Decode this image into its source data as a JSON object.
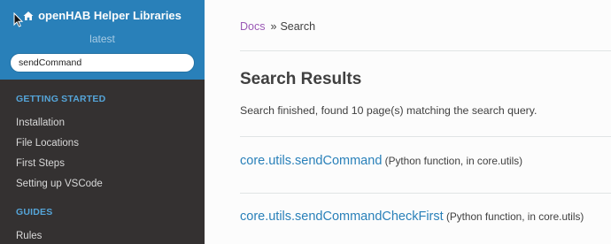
{
  "sidebar": {
    "brand": "openHAB Helper Libraries",
    "version": "latest",
    "search_value": "sendCommand",
    "sections": [
      {
        "caption": "GETTING STARTED",
        "items": [
          "Installation",
          "File Locations",
          "First Steps",
          "Setting up VSCode"
        ]
      },
      {
        "caption": "GUIDES",
        "items": [
          "Rules"
        ]
      }
    ]
  },
  "breadcrumb": {
    "home": "Docs",
    "separator": "»",
    "current": "Search"
  },
  "main": {
    "title": "Search Results",
    "summary": "Search finished, found 10 page(s) matching the search query.",
    "results": [
      {
        "link": "core.utils.sendCommand",
        "desc": "(Python function, in core.utils)"
      },
      {
        "link": "core.utils.sendCommandCheckFirst",
        "desc": "(Python function, in core.utils)"
      }
    ]
  },
  "colors": {
    "sidebar_top": "#2980b9",
    "sidebar_bg": "#343131",
    "caption": "#55a5d9",
    "link": "#2980b9",
    "breadcrumb_link": "#9b59b6"
  }
}
